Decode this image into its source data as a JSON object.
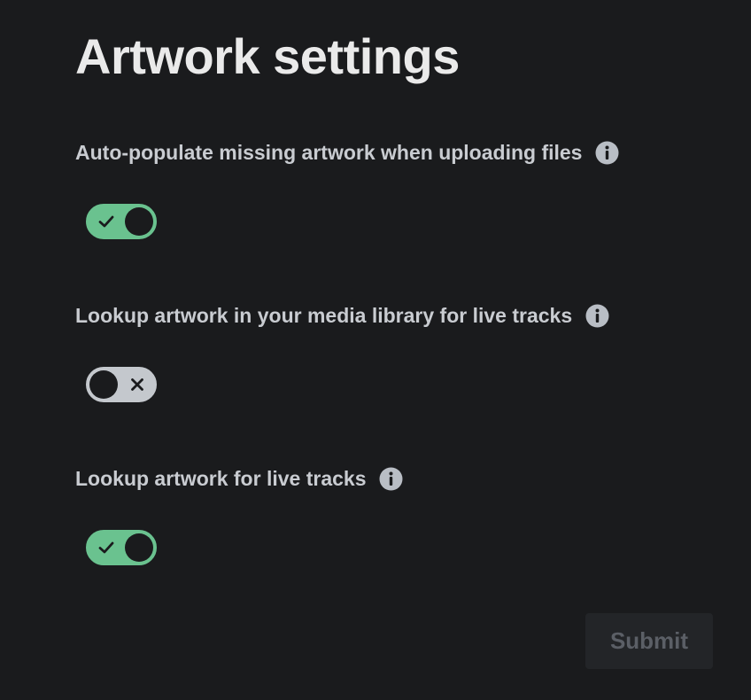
{
  "page": {
    "title": "Artwork settings"
  },
  "settings": [
    {
      "label": "Auto-populate missing artwork when uploading files",
      "enabled": true,
      "info_icon": "info-icon"
    },
    {
      "label": "Lookup artwork in your media library for live tracks",
      "enabled": false,
      "info_icon": "info-icon"
    },
    {
      "label": "Lookup artwork for live tracks",
      "enabled": true,
      "info_icon": "info-icon"
    }
  ],
  "actions": {
    "submit_label": "Submit",
    "submit_disabled": true
  },
  "colors": {
    "background": "#1a1b1d",
    "toggle_on": "#6ac28f",
    "toggle_off": "#c4c8cd",
    "label_text": "#c9ccd1",
    "info_icon": "#b9bec5"
  }
}
